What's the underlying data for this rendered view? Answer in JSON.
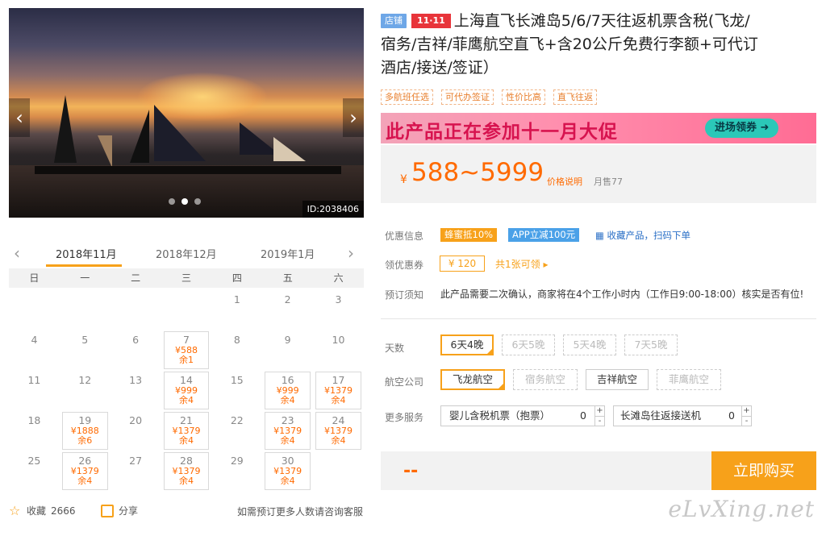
{
  "hero": {
    "id_label": "ID:2038406",
    "dots": 3,
    "active_dot": 1
  },
  "calendar": {
    "months": [
      "2018年11月",
      "2018年12月",
      "2019年1月"
    ],
    "active_month": 0,
    "weekdays": [
      "日",
      "一",
      "二",
      "三",
      "四",
      "五",
      "六"
    ],
    "weeks": [
      [
        {
          "d": ""
        },
        {
          "d": ""
        },
        {
          "d": ""
        },
        {
          "d": ""
        },
        {
          "d": "1"
        },
        {
          "d": "2"
        },
        {
          "d": "3"
        }
      ],
      [
        {
          "d": "4"
        },
        {
          "d": "5"
        },
        {
          "d": "6"
        },
        {
          "d": "7",
          "p": "¥588",
          "s": "余1"
        },
        {
          "d": "8"
        },
        {
          "d": "9"
        },
        {
          "d": "10"
        }
      ],
      [
        {
          "d": "11"
        },
        {
          "d": "12"
        },
        {
          "d": "13"
        },
        {
          "d": "14",
          "p": "¥999",
          "s": "余4"
        },
        {
          "d": "15"
        },
        {
          "d": "16",
          "p": "¥999",
          "s": "余4"
        },
        {
          "d": "17",
          "p": "¥1379",
          "s": "余4"
        }
      ],
      [
        {
          "d": "18"
        },
        {
          "d": "19",
          "p": "¥1888",
          "s": "余6"
        },
        {
          "d": "20"
        },
        {
          "d": "21",
          "p": "¥1379",
          "s": "余4"
        },
        {
          "d": "22"
        },
        {
          "d": "23",
          "p": "¥1379",
          "s": "余4"
        },
        {
          "d": "24",
          "p": "¥1379",
          "s": "余4"
        }
      ],
      [
        {
          "d": "25"
        },
        {
          "d": "26",
          "p": "¥1379",
          "s": "余4"
        },
        {
          "d": "27"
        },
        {
          "d": "28",
          "p": "¥1379",
          "s": "余4"
        },
        {
          "d": "29"
        },
        {
          "d": "30",
          "p": "¥1379",
          "s": "余4"
        },
        {
          "d": ""
        }
      ]
    ]
  },
  "footer": {
    "favorite_label": "收藏",
    "favorite_count": "2666",
    "share_label": "分享",
    "hint": "如需预订更多人数请咨询客服"
  },
  "product": {
    "store_tag": "店铺",
    "promo_tag": "11·11",
    "title_lines": [
      "上海直飞长滩岛5/6/7天往返机票含税(飞龙/",
      "宿务/吉祥/菲鹰航空直飞+含20公斤免费行李额+可代订",
      "酒店/接送/签证）"
    ],
    "features": [
      "多航班任选",
      "可代办签证",
      "性价比高",
      "直飞往返"
    ],
    "banner_text_a": "此产品正在参加",
    "banner_text_b": "十一月大促",
    "banner_button": "进场领券 ➜",
    "price_currency": "¥",
    "price": "588~5999",
    "price_note": "价格说明",
    "monthly_sales": "月售77"
  },
  "offers": {
    "label_discount": "优惠信息",
    "promo1": "蜂蜜抵10%",
    "promo1_color": "#f7a11a",
    "promo2": "APP立减100元",
    "promo2_color": "#4aa1e8",
    "qr_text": "收藏产品，扫码下单",
    "label_coupon": "领优惠券",
    "coupon_value": "¥ 120",
    "coupon_link": "共1张可领 ▸",
    "label_notice": "预订须知",
    "notice_text": "此产品需要二次确认，商家将在4个工作小时内（工作日9:00-18:00）核实是否有位!"
  },
  "options": {
    "label_days": "天数",
    "days": [
      "6天4晚",
      "6天5晚",
      "5天4晚",
      "7天5晚"
    ],
    "label_airline": "航空公司",
    "airlines": [
      "飞龙航空",
      "宿务航空",
      "吉祥航空",
      "菲鹰航空"
    ],
    "label_services": "更多服务",
    "services": [
      {
        "name": "婴儿含税机票（抱票）",
        "qty": "0"
      },
      {
        "name": "长滩岛往返接送机",
        "qty": "0"
      }
    ],
    "stepper_plus": "+",
    "stepper_minus": "-"
  },
  "buy": {
    "total": "--",
    "button": "立即购买"
  },
  "watermark": "eLvXing.net",
  "colors": {
    "accent": "#f7a11a",
    "price": "#ff6a00",
    "link": "#2a6fc6"
  }
}
